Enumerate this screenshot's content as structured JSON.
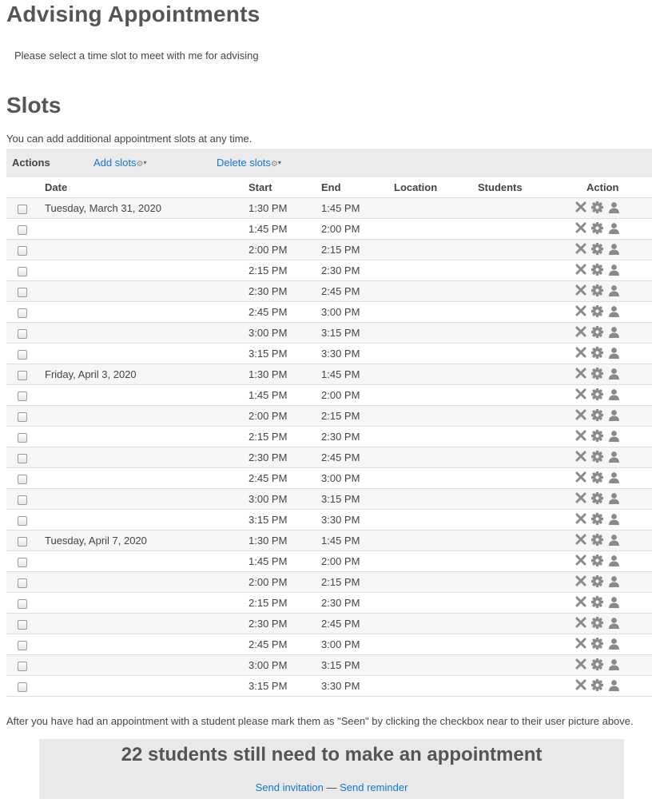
{
  "header": {
    "title": "Advising Appointments",
    "intro": "Please select a time slot to meet with me for advising"
  },
  "slots_section": {
    "title": "Slots",
    "note": "You can add additional appointment slots at any time."
  },
  "actions_bar": {
    "label": "Actions",
    "add_slots": "Add slots",
    "delete_slots": "Delete slots"
  },
  "table": {
    "headers": [
      "Date",
      "Start",
      "End",
      "Location",
      "Students",
      "Action"
    ],
    "rows": [
      {
        "date": "Tuesday, March 31, 2020",
        "start": "1:30 PM",
        "end": "1:45 PM"
      },
      {
        "date": "",
        "start": "1:45 PM",
        "end": "2:00 PM"
      },
      {
        "date": "",
        "start": "2:00 PM",
        "end": "2:15 PM"
      },
      {
        "date": "",
        "start": "2:15 PM",
        "end": "2:30 PM"
      },
      {
        "date": "",
        "start": "2:30 PM",
        "end": "2:45 PM"
      },
      {
        "date": "",
        "start": "2:45 PM",
        "end": "3:00 PM"
      },
      {
        "date": "",
        "start": "3:00 PM",
        "end": "3:15 PM"
      },
      {
        "date": "",
        "start": "3:15 PM",
        "end": "3:30 PM"
      },
      {
        "date": "Friday, April 3, 2020",
        "start": "1:30 PM",
        "end": "1:45 PM"
      },
      {
        "date": "",
        "start": "1:45 PM",
        "end": "2:00 PM"
      },
      {
        "date": "",
        "start": "2:00 PM",
        "end": "2:15 PM"
      },
      {
        "date": "",
        "start": "2:15 PM",
        "end": "2:30 PM"
      },
      {
        "date": "",
        "start": "2:30 PM",
        "end": "2:45 PM"
      },
      {
        "date": "",
        "start": "2:45 PM",
        "end": "3:00 PM"
      },
      {
        "date": "",
        "start": "3:00 PM",
        "end": "3:15 PM"
      },
      {
        "date": "",
        "start": "3:15 PM",
        "end": "3:30 PM"
      },
      {
        "date": "Tuesday, April 7, 2020",
        "start": "1:30 PM",
        "end": "1:45 PM"
      },
      {
        "date": "",
        "start": "1:45 PM",
        "end": "2:00 PM"
      },
      {
        "date": "",
        "start": "2:00 PM",
        "end": "2:15 PM"
      },
      {
        "date": "",
        "start": "2:15 PM",
        "end": "2:30 PM"
      },
      {
        "date": "",
        "start": "2:30 PM",
        "end": "2:45 PM"
      },
      {
        "date": "",
        "start": "2:45 PM",
        "end": "3:00 PM"
      },
      {
        "date": "",
        "start": "3:00 PM",
        "end": "3:15 PM"
      },
      {
        "date": "",
        "start": "3:15 PM",
        "end": "3:30 PM"
      }
    ],
    "action_icons": [
      "delete-icon",
      "gear-icon",
      "user-icon"
    ]
  },
  "after_note": "After you have had an appointment with a student please mark them as \"Seen\" by clicking the checkbox near to their user picture above.",
  "summary": {
    "heading": "22 students still need to make an appointment",
    "send_invitation": "Send invitation",
    "separator": "—",
    "send_reminder": "Send reminder"
  },
  "colors": {
    "link": "#1177d1",
    "heading": "#555555",
    "bar_background": "#ebebeb",
    "icon": "#8a8a8a"
  }
}
